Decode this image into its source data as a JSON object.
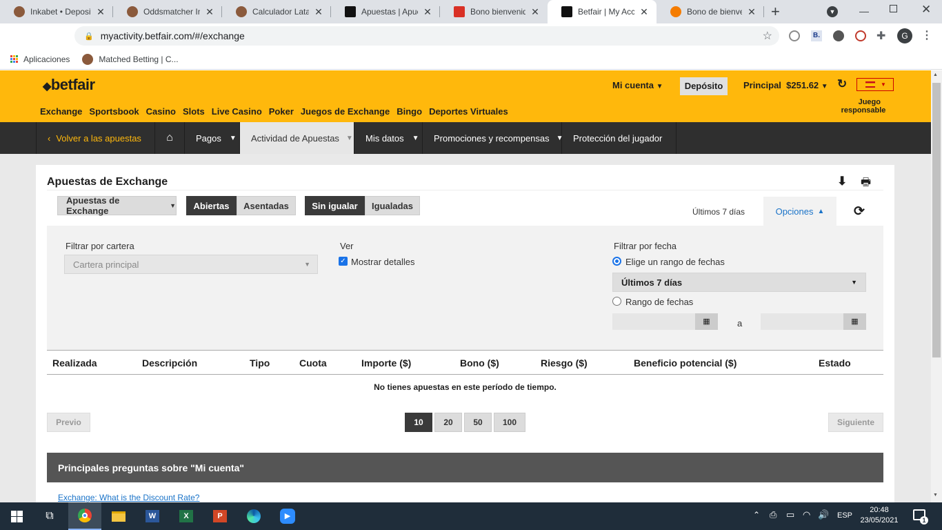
{
  "browser": {
    "tabs": [
      {
        "title": "Inkabet • Deposit",
        "color": "#8b5a3c"
      },
      {
        "title": "Oddsmatcher Ink",
        "color": "#8b5a3c"
      },
      {
        "title": "Calculador Latam",
        "color": "#8b5a3c"
      },
      {
        "title": "Apuestas | Apues",
        "color": "#111111"
      },
      {
        "title": "Bono bienvenida",
        "color": "#d93025"
      },
      {
        "title": "Betfair | My Acco",
        "color": "#111111"
      },
      {
        "title": "Bono de bienven",
        "color": "#f57c00"
      }
    ],
    "url": "myactivity.betfair.com/#/exchange",
    "bookmarks": [
      "Aplicaciones",
      "Matched Betting | C..."
    ]
  },
  "header": {
    "logo": "betfair",
    "products": [
      "Exchange",
      "Sportsbook",
      "Casino",
      "Slots",
      "Live Casino",
      "Poker",
      "Juegos de Exchange",
      "Bingo",
      "Deportes Virtuales"
    ],
    "mi_cuenta": "Mi cuenta",
    "deposito": "Depósito",
    "principal_label": "Principal",
    "balance": "$251.62",
    "juego_responsable_1": "Juego",
    "juego_responsable_2": "responsable"
  },
  "subnav": {
    "back": "Volver a las apuestas",
    "pagos": "Pagos",
    "actividad": "Actividad de Apuestas",
    "datos": "Mis datos",
    "promos": "Promociones y recompensas",
    "proteccion": "Protección del jugador"
  },
  "main": {
    "title": "Apuestas de Exchange",
    "type_select": "Apuestas de Exchange",
    "seg1": [
      "Abiertas",
      "Asentadas"
    ],
    "seg2": [
      "Sin igualar",
      "Igualadas"
    ],
    "range_label": "Últimos 7 días",
    "options": "Opciones",
    "filter_cartera_label": "Filtrar por cartera",
    "cartera_value": "Cartera principal",
    "ver_label": "Ver",
    "mostrar_detalles": "Mostrar detalles",
    "filtrar_fecha_label": "Filtrar por fecha",
    "elige_rango": "Elige un rango de fechas",
    "rango_value": "Últimos 7 días",
    "rango_fechas": "Rango de fechas",
    "a": "a",
    "columns": [
      "Realizada",
      "Descripción",
      "Tipo",
      "Cuota",
      "Importe ($)",
      "Bono ($)",
      "Riesgo ($)",
      "Beneficio potencial ($)",
      "Estado"
    ],
    "empty": "No tienes apuestas en este período de tiempo.",
    "previo": "Previo",
    "siguiente": "Siguiente",
    "page_sizes": [
      "10",
      "20",
      "50",
      "100"
    ],
    "faq_title": "Principales preguntas sobre \"Mi cuenta\"",
    "faq_link": "Exchange: What is the Discount Rate?"
  },
  "taskbar": {
    "lang": "ESP",
    "time": "20:48",
    "date": "23/05/2021",
    "notif_count": "1"
  }
}
